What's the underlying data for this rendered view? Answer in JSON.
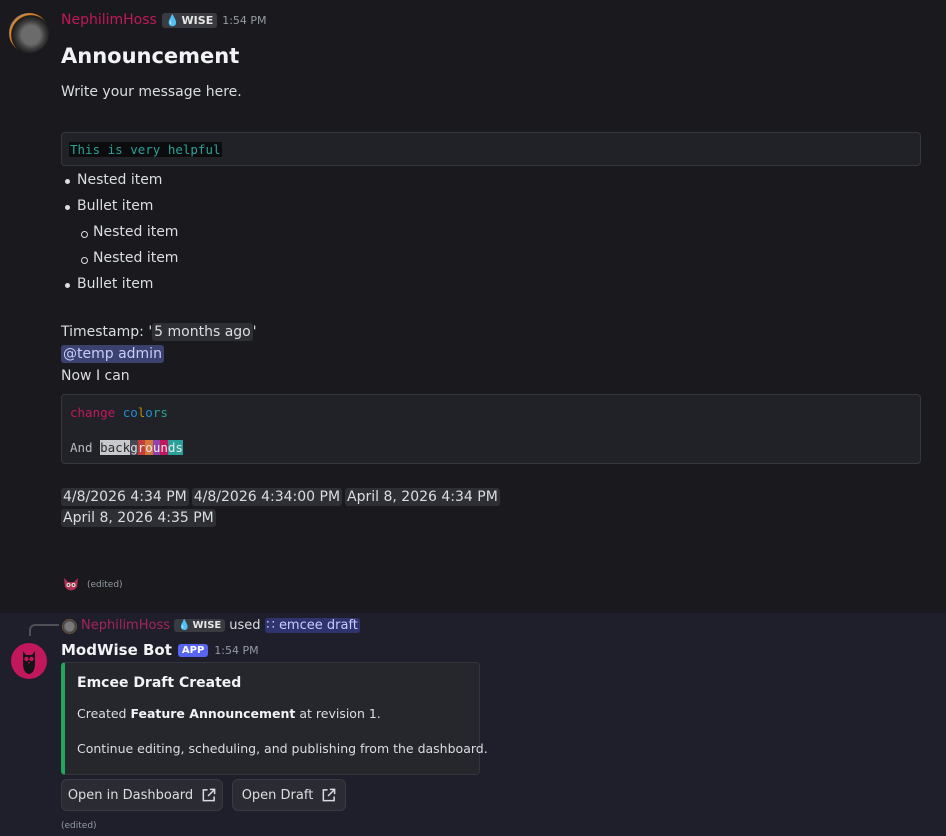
{
  "message1": {
    "author": "NephilimHoss",
    "badge": "WISE",
    "time": "1:54 PM",
    "heading": "Announcement",
    "intro": "Write your message here.",
    "code_line": "This is very helpful",
    "list": [
      {
        "label": "Nested item",
        "level": 0
      },
      {
        "label": "Bullet item",
        "level": 0
      },
      {
        "label": "Nested item",
        "level": 1
      },
      {
        "label": "Nested item",
        "level": 1
      },
      {
        "label": "Bullet item",
        "level": 0
      }
    ],
    "timestamp_prefix": "Timestamp: '",
    "timestamp_value": "5 months ago",
    "timestamp_suffix": "'",
    "mention": "@temp admin",
    "now_text": "Now I can",
    "ansi_line1": [
      "change",
      " ",
      "co",
      "l",
      "o",
      "rs"
    ],
    "ansi_line2_prefix": "And ",
    "ansi_line2_parts": [
      "back",
      "g",
      "r",
      "o",
      "u",
      "n",
      "ds"
    ],
    "dates": [
      "4/8/2026 4:34 PM",
      "4/8/2026 4:34:00 PM",
      "April 8, 2026 4:34 PM",
      "April 8, 2026 4:35 PM"
    ],
    "edited": "(edited)"
  },
  "message2": {
    "reply_author": "NephilimHoss",
    "reply_badge": "WISE",
    "reply_used": "used",
    "reply_command": "emcee draft",
    "bot_name": "ModWise Bot",
    "app_tag": "APP",
    "time": "1:54 PM",
    "embed": {
      "title": "Emcee Draft Created",
      "line1_prefix": "Created ",
      "line1_bold": "Feature Announcement",
      "line1_suffix": " at revision 1.",
      "line2": "Continue editing, scheduling, and publishing from the dashboard.",
      "accent": "#23a55a"
    },
    "buttons": [
      "Open in Dashboard",
      "Open Draft"
    ],
    "edited": "(edited)"
  }
}
